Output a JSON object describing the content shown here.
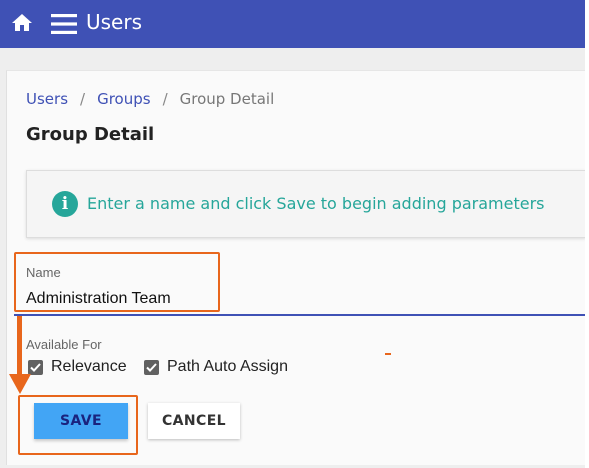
{
  "app": {
    "title": "Users",
    "icons": {
      "home": "home-icon",
      "menu": "hamburger-menu-icon"
    },
    "colors": {
      "primary": "#3f51b5",
      "info": "#26a69a",
      "save": "#42a5f5",
      "annotation": "#e8661c"
    }
  },
  "breadcrumb": {
    "items": [
      "Users",
      "Groups",
      "Group Detail"
    ],
    "separator": "/"
  },
  "page": {
    "title": "Group Detail"
  },
  "info": {
    "icon_glyph": "i",
    "text": "Enter a name and click Save to begin adding parameters"
  },
  "form": {
    "name": {
      "label": "Name",
      "value": "Administration Team"
    },
    "available_for": {
      "label": "Available For",
      "options": [
        {
          "label": "Relevance",
          "checked": true
        },
        {
          "label": "Path Auto Assign",
          "checked": true
        }
      ]
    },
    "actions": {
      "save_label": "SAVE",
      "cancel_label": "CANCEL"
    }
  }
}
